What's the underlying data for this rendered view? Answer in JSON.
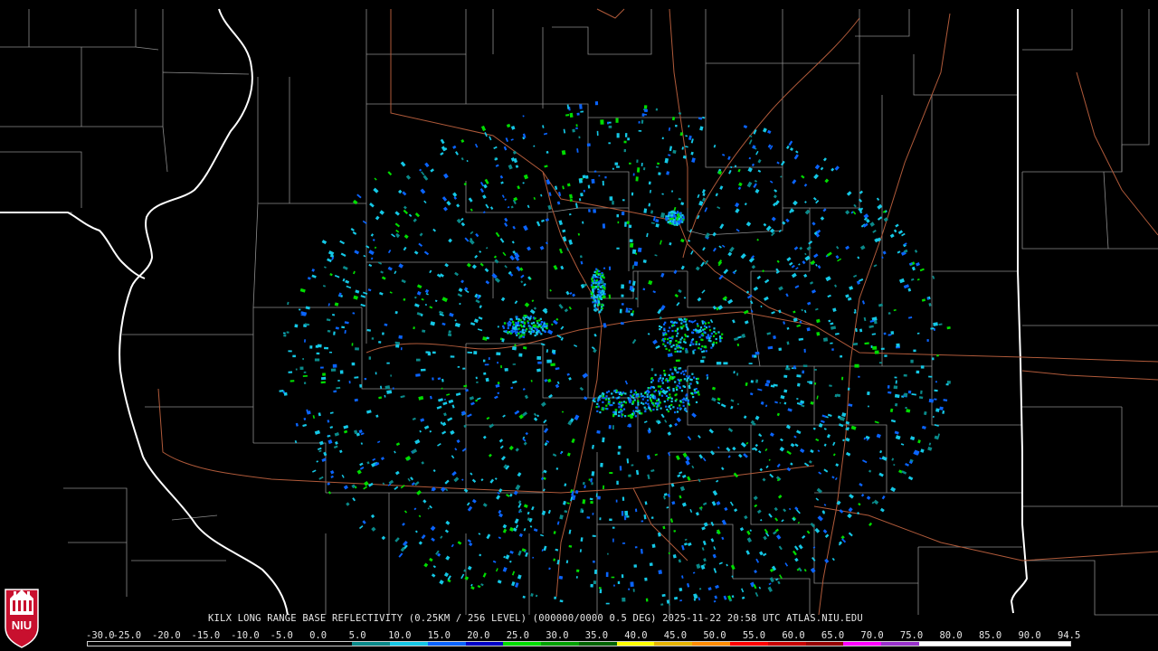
{
  "title": "KILX LONG RANGE BASE REFLECTIVITY (0.25KM / 256 LEVEL) (000000/0000 0.5 DEG) 2025-11-22 20:58 UTC  ATLAS.NIU.EDU",
  "logo_text": "NIU",
  "color_scale": {
    "labels": [
      "-30.0",
      "-25.0",
      "-20.0",
      "-15.0",
      "-10.0",
      "-5.0",
      "0.0",
      "5.0",
      "10.0",
      "15.0",
      "20.0",
      "25.0",
      "30.0",
      "35.0",
      "40.0",
      "45.0",
      "50.0",
      "55.0",
      "60.0",
      "65.0",
      "70.0",
      "75.0",
      "80.0",
      "85.0",
      "90.0",
      "94.5"
    ],
    "colors": [
      "#000000",
      "#000000",
      "#000000",
      "#000000",
      "#000000",
      "#000000",
      "#000000",
      "#0a8a8a",
      "#14c8e6",
      "#0a64ff",
      "#0000c8",
      "#00dc00",
      "#00a000",
      "#006400",
      "#ffff00",
      "#e6b400",
      "#ff8c00",
      "#ff0000",
      "#c80000",
      "#960000",
      "#ff00ff",
      "#9932cc",
      "#ffffff",
      "#ffffff",
      "#ffffff",
      "#ffffff"
    ]
  }
}
